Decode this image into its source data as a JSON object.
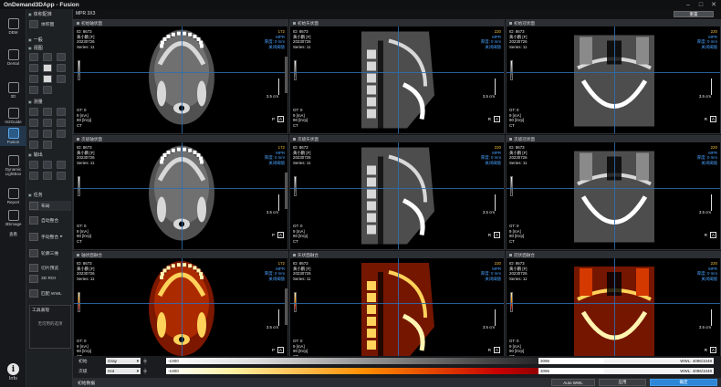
{
  "app": {
    "title": "OnDemand3DApp - Fusion"
  },
  "left_nav": {
    "items": [
      {
        "label": "DBM",
        "icon": "database-icon"
      },
      {
        "label": "Dental",
        "icon": "tooth-icon"
      },
      {
        "label": "3D",
        "icon": "cube-icon"
      },
      {
        "label": "In2Guide",
        "icon": "guide-icon"
      },
      {
        "label": "Fusion",
        "icon": "fusion-icon",
        "active": true
      },
      {
        "label": "Dynamic\nLightBox",
        "icon": "lightbox-icon"
      },
      {
        "label": "Report",
        "icon": "report-icon"
      },
      {
        "label": "3Dimage",
        "icon": "image-icon"
      },
      {
        "label": "查看",
        "icon": "view-icon"
      }
    ],
    "info_label": "Info"
  },
  "tool_panel": {
    "sections": {
      "body_rec": "体积配准",
      "body_rec_button": "体积图",
      "general": "一般",
      "view": "视图",
      "measure": "测量",
      "output": "输出",
      "task": "任务"
    },
    "tasks": [
      {
        "label": "布局"
      },
      {
        "label": "自动整合"
      },
      {
        "label": "手动整合"
      },
      {
        "label": "轮廓三维"
      },
      {
        "label": "切片预览"
      },
      {
        "label": "3D ROI"
      },
      {
        "label": "匹配 WWL"
      }
    ],
    "toolbox": {
      "title": "工具表现",
      "message": "无可用的选项"
    }
  },
  "main": {
    "layout_label": "MPR 3X3",
    "reset_label": "重置",
    "viewports": [
      {
        "title": "初始轴状面",
        "slice": "172",
        "mode": "MPR",
        "thick": "厚度: 0 mm",
        "tag": "关闭阈值",
        "kind": "axial",
        "palette": "gray",
        "orient": "A",
        "orient2": "P"
      },
      {
        "title": "初始矢状面",
        "slice": "220",
        "mode": "MPR",
        "thick": "厚度: 0 mm",
        "tag": "关闭阈值",
        "kind": "sagittal",
        "palette": "gray",
        "orient": "A",
        "orient2": "R"
      },
      {
        "title": "初始冠状面",
        "slice": "220",
        "mode": "MPR",
        "thick": "厚度: 0 mm",
        "tag": "关闭阈值",
        "kind": "coronal",
        "palette": "gray",
        "orient": "A",
        "orient2": "R"
      },
      {
        "title": "次级轴状面",
        "slice": "172",
        "mode": "MPR",
        "thick": "厚度: 0 mm",
        "tag": "关闭阈值",
        "kind": "axial",
        "palette": "gray",
        "orient": "A",
        "orient2": "P"
      },
      {
        "title": "次级矢状面",
        "slice": "220",
        "mode": "MPR",
        "thick": "厚度: 0 mm",
        "tag": "关闭阈值",
        "kind": "sagittal",
        "palette": "gray",
        "orient": "A",
        "orient2": "R"
      },
      {
        "title": "次级冠状面",
        "slice": "220",
        "mode": "MPR",
        "thick": "厚度: 0 mm",
        "tag": "关闭阈值",
        "kind": "coronal",
        "palette": "gray",
        "orient": "A",
        "orient2": "R"
      },
      {
        "title": "轴状面融合",
        "slice": "172",
        "mode": "MPR",
        "thick": "厚度: 0 mm",
        "tag": "关闭阈值",
        "kind": "axial",
        "palette": "hot",
        "orient": "A",
        "orient2": "P"
      },
      {
        "title": "矢状面融合",
        "slice": "220",
        "mode": "MPR",
        "thick": "厚度: 0 mm",
        "tag": "关闭阈值",
        "kind": "sagittal",
        "palette": "hot",
        "orient": "A",
        "orient2": "R"
      },
      {
        "title": "冠状面融合",
        "slice": "220",
        "mode": "MPR",
        "thick": "厚度: 0 mm",
        "tag": "关闭阈值",
        "kind": "coronal",
        "palette": "hot",
        "orient": "A",
        "orient2": "R"
      }
    ],
    "patient": {
      "id": "ID: 8673",
      "name": "黄小鹏 [F]",
      "date": "20230726",
      "series": "Series: 11"
    },
    "acq": {
      "gt": "GT: 0",
      "ma": "9 [mA]",
      "kvp": "90 [kVp]",
      "modality": "CT"
    },
    "scale_label": "3.5 cm"
  },
  "lut": {
    "primary": {
      "label": "初始",
      "palette": "Gray",
      "min": "-1000",
      "max": "3096",
      "wwl": "WWL: 4096/1048"
    },
    "secondary": {
      "label": "次级",
      "palette": "Hot",
      "min": "-1000",
      "max": "3096",
      "wwl": "WWL: 4096/1048"
    }
  },
  "bottom_bar": {
    "label": "初始数据",
    "auto_wwl": "Auto WWL",
    "apply": "应用",
    "ok": "确定"
  },
  "colors": {
    "accent": "#2d87d6",
    "crosshair": "#2e6fb0",
    "slice_number": "#f0c23a",
    "mpr_text": "#4aa3ff"
  }
}
